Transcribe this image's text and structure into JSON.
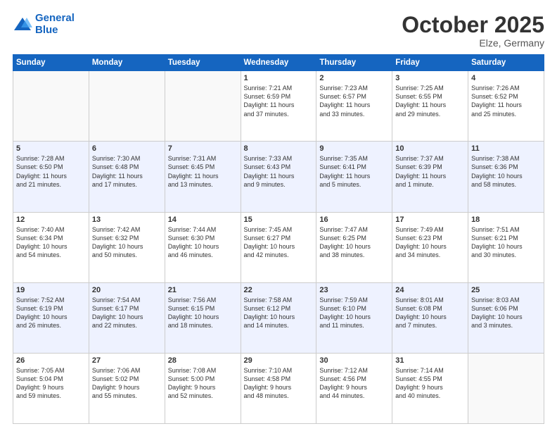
{
  "header": {
    "logo_line1": "General",
    "logo_line2": "Blue",
    "month": "October 2025",
    "location": "Elze, Germany"
  },
  "weekdays": [
    "Sunday",
    "Monday",
    "Tuesday",
    "Wednesday",
    "Thursday",
    "Friday",
    "Saturday"
  ],
  "weeks": [
    [
      {
        "day": "",
        "info": ""
      },
      {
        "day": "",
        "info": ""
      },
      {
        "day": "",
        "info": ""
      },
      {
        "day": "1",
        "info": "Sunrise: 7:21 AM\nSunset: 6:59 PM\nDaylight: 11 hours\nand 37 minutes."
      },
      {
        "day": "2",
        "info": "Sunrise: 7:23 AM\nSunset: 6:57 PM\nDaylight: 11 hours\nand 33 minutes."
      },
      {
        "day": "3",
        "info": "Sunrise: 7:25 AM\nSunset: 6:55 PM\nDaylight: 11 hours\nand 29 minutes."
      },
      {
        "day": "4",
        "info": "Sunrise: 7:26 AM\nSunset: 6:52 PM\nDaylight: 11 hours\nand 25 minutes."
      }
    ],
    [
      {
        "day": "5",
        "info": "Sunrise: 7:28 AM\nSunset: 6:50 PM\nDaylight: 11 hours\nand 21 minutes."
      },
      {
        "day": "6",
        "info": "Sunrise: 7:30 AM\nSunset: 6:48 PM\nDaylight: 11 hours\nand 17 minutes."
      },
      {
        "day": "7",
        "info": "Sunrise: 7:31 AM\nSunset: 6:45 PM\nDaylight: 11 hours\nand 13 minutes."
      },
      {
        "day": "8",
        "info": "Sunrise: 7:33 AM\nSunset: 6:43 PM\nDaylight: 11 hours\nand 9 minutes."
      },
      {
        "day": "9",
        "info": "Sunrise: 7:35 AM\nSunset: 6:41 PM\nDaylight: 11 hours\nand 5 minutes."
      },
      {
        "day": "10",
        "info": "Sunrise: 7:37 AM\nSunset: 6:39 PM\nDaylight: 11 hours\nand 1 minute."
      },
      {
        "day": "11",
        "info": "Sunrise: 7:38 AM\nSunset: 6:36 PM\nDaylight: 10 hours\nand 58 minutes."
      }
    ],
    [
      {
        "day": "12",
        "info": "Sunrise: 7:40 AM\nSunset: 6:34 PM\nDaylight: 10 hours\nand 54 minutes."
      },
      {
        "day": "13",
        "info": "Sunrise: 7:42 AM\nSunset: 6:32 PM\nDaylight: 10 hours\nand 50 minutes."
      },
      {
        "day": "14",
        "info": "Sunrise: 7:44 AM\nSunset: 6:30 PM\nDaylight: 10 hours\nand 46 minutes."
      },
      {
        "day": "15",
        "info": "Sunrise: 7:45 AM\nSunset: 6:27 PM\nDaylight: 10 hours\nand 42 minutes."
      },
      {
        "day": "16",
        "info": "Sunrise: 7:47 AM\nSunset: 6:25 PM\nDaylight: 10 hours\nand 38 minutes."
      },
      {
        "day": "17",
        "info": "Sunrise: 7:49 AM\nSunset: 6:23 PM\nDaylight: 10 hours\nand 34 minutes."
      },
      {
        "day": "18",
        "info": "Sunrise: 7:51 AM\nSunset: 6:21 PM\nDaylight: 10 hours\nand 30 minutes."
      }
    ],
    [
      {
        "day": "19",
        "info": "Sunrise: 7:52 AM\nSunset: 6:19 PM\nDaylight: 10 hours\nand 26 minutes."
      },
      {
        "day": "20",
        "info": "Sunrise: 7:54 AM\nSunset: 6:17 PM\nDaylight: 10 hours\nand 22 minutes."
      },
      {
        "day": "21",
        "info": "Sunrise: 7:56 AM\nSunset: 6:15 PM\nDaylight: 10 hours\nand 18 minutes."
      },
      {
        "day": "22",
        "info": "Sunrise: 7:58 AM\nSunset: 6:12 PM\nDaylight: 10 hours\nand 14 minutes."
      },
      {
        "day": "23",
        "info": "Sunrise: 7:59 AM\nSunset: 6:10 PM\nDaylight: 10 hours\nand 11 minutes."
      },
      {
        "day": "24",
        "info": "Sunrise: 8:01 AM\nSunset: 6:08 PM\nDaylight: 10 hours\nand 7 minutes."
      },
      {
        "day": "25",
        "info": "Sunrise: 8:03 AM\nSunset: 6:06 PM\nDaylight: 10 hours\nand 3 minutes."
      }
    ],
    [
      {
        "day": "26",
        "info": "Sunrise: 7:05 AM\nSunset: 5:04 PM\nDaylight: 9 hours\nand 59 minutes."
      },
      {
        "day": "27",
        "info": "Sunrise: 7:06 AM\nSunset: 5:02 PM\nDaylight: 9 hours\nand 55 minutes."
      },
      {
        "day": "28",
        "info": "Sunrise: 7:08 AM\nSunset: 5:00 PM\nDaylight: 9 hours\nand 52 minutes."
      },
      {
        "day": "29",
        "info": "Sunrise: 7:10 AM\nSunset: 4:58 PM\nDaylight: 9 hours\nand 48 minutes."
      },
      {
        "day": "30",
        "info": "Sunrise: 7:12 AM\nSunset: 4:56 PM\nDaylight: 9 hours\nand 44 minutes."
      },
      {
        "day": "31",
        "info": "Sunrise: 7:14 AM\nSunset: 4:55 PM\nDaylight: 9 hours\nand 40 minutes."
      },
      {
        "day": "",
        "info": ""
      }
    ]
  ]
}
